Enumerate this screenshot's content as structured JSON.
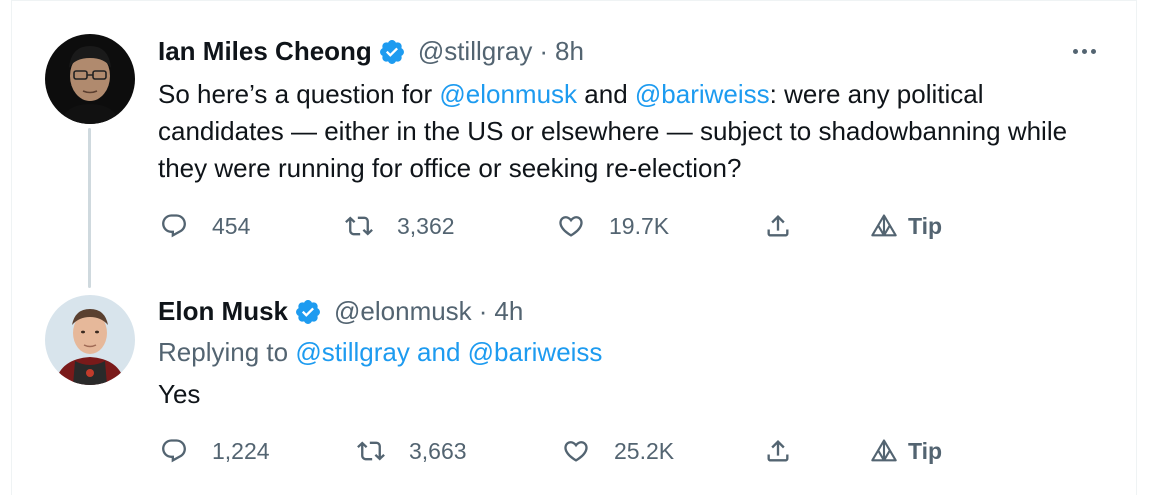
{
  "tweets": [
    {
      "display_name": "Ian Miles Cheong",
      "handle": "@stillgray",
      "separator": "·",
      "time": "8h",
      "text_parts": {
        "p1": "So here’s a question for ",
        "m1": "@elonmusk",
        "p2": " and ",
        "m2": "@bariweiss",
        "p3": ": were any political candidates — either in the US or elsewhere — subject to shadowbanning while they were running for office or seeking re-election?"
      },
      "actions": {
        "replies": "454",
        "retweets": "3,362",
        "likes": "19.7K",
        "tip": "Tip"
      }
    },
    {
      "display_name": "Elon Musk",
      "handle": "@elonmusk",
      "separator": "·",
      "time": "4h",
      "replying_prefix": "Replying to ",
      "replying_to": "@stillgray and @bariweiss",
      "text": "Yes",
      "actions": {
        "replies": "1,224",
        "retweets": "3,663",
        "likes": "25.2K",
        "tip": "Tip"
      }
    }
  ],
  "colors": {
    "link": "#1d9bf0",
    "secondary_text": "#536471",
    "primary_text": "#0f1419",
    "verified": "#1d9bf0"
  },
  "icons": [
    "verified-badge-icon",
    "more-icon",
    "reply-icon",
    "retweet-icon",
    "like-icon",
    "share-icon",
    "tip-icon"
  ]
}
